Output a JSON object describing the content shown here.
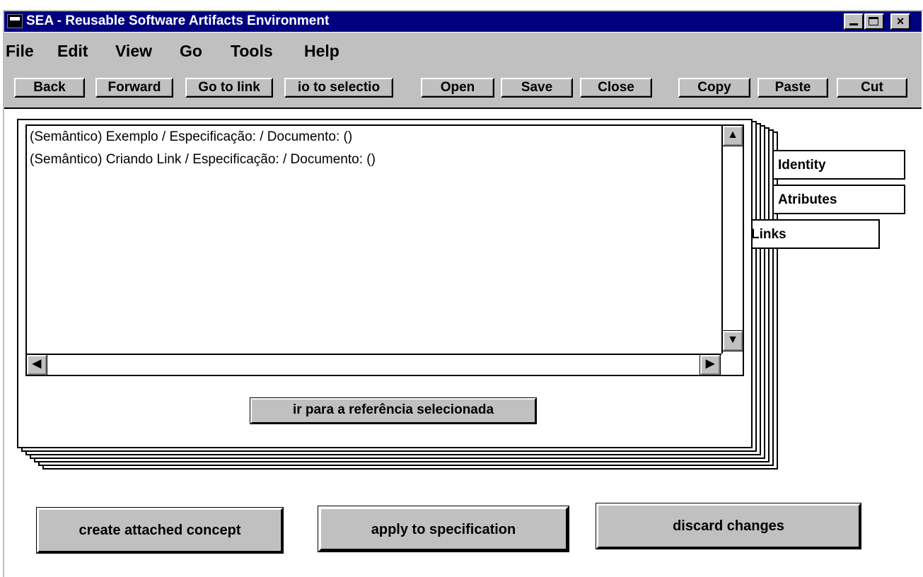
{
  "window": {
    "title": "SEA - Reusable Software Artifacts Environment",
    "controls": {
      "close_glyph": "×"
    }
  },
  "menu": [
    "File",
    "Edit",
    "View",
    "Go",
    "Tools",
    "Help"
  ],
  "toolbar": {
    "back": "Back",
    "forward": "Forward",
    "go_to_link": "Go to link",
    "go_to_selection": "io to selectio",
    "open": "Open",
    "save": "Save",
    "close": "Close",
    "copy": "Copy",
    "paste": "Paste",
    "cut": "Cut"
  },
  "links_list": {
    "items": [
      "(Semântico) Exemplo / Especificação:  / Documento:  ()",
      "(Semântico) Criando Link / Especificação:  / Documento:  ()"
    ],
    "scroll_glyphs": {
      "up": "▲",
      "down": "▼",
      "left": "◀",
      "right": "▶"
    }
  },
  "go_reference_button": "ir para a referência selecionada",
  "tabs": {
    "identity": "Identity",
    "atributes": "Atributes",
    "links": "Links",
    "active": "Links"
  },
  "actions": {
    "create": "create attached concept",
    "apply": "apply to specification",
    "discard": "discard changes"
  }
}
